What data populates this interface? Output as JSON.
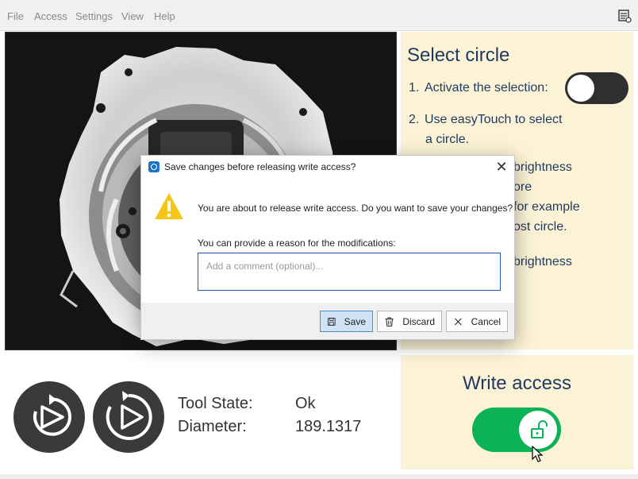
{
  "menu": {
    "items": [
      "File",
      "Access",
      "Settings",
      "View",
      "Help"
    ],
    "icon_right": "settings-list-icon"
  },
  "instructions": {
    "title": "Select circle",
    "steps": [
      {
        "num": "1.",
        "text": "Activate the selection:"
      },
      {
        "num": "2.",
        "line1": "Use easyTouch to select",
        "line2": "a circle."
      }
    ],
    "obscured_fragments": [
      "brightness",
      "ore",
      "for example",
      "ost circle.",
      "brightness"
    ],
    "selection_toggle": "off"
  },
  "tool": {
    "state_label": "Tool State:",
    "state_value": "Ok",
    "diameter_label": "Diameter:",
    "diameter_value": "189.1317",
    "buttons": [
      "run-once-icon",
      "run-continuous-icon"
    ]
  },
  "write_access": {
    "title": "Write access",
    "toggle": "on",
    "knob_icon": "unlock-icon"
  },
  "dialog": {
    "title": "Save changes before releasing write access?",
    "message": "You are about to release write access. Do you want to save your changes?",
    "reason_label": "You can provide a reason for the modifications:",
    "comment_placeholder": "Add a comment (optional)...",
    "comment_value": "",
    "save_label": "Save",
    "discard_label": "Discard",
    "cancel_label": "Cancel"
  },
  "colors": {
    "accent_text": "#1e3a5f",
    "panel_bg": "#fcf3d6",
    "toggle_on": "#0bb357",
    "warning": "#f5c518"
  }
}
